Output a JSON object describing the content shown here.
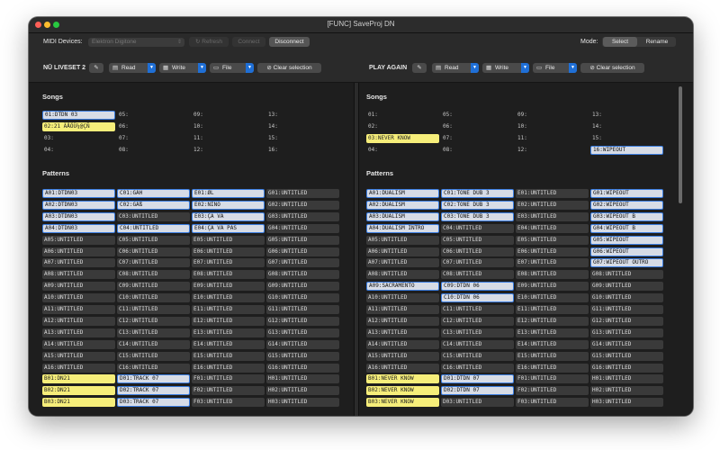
{
  "window": {
    "title": "[FUNC] SaveProj DN"
  },
  "toolbar": {
    "midi_label": "MIDI Devices:",
    "device_value": "Elektron Digitone",
    "refresh_label": "Refresh",
    "connect_label": "Connect",
    "disconnect_label": "Disconnect",
    "mode_label": "Mode:",
    "mode_select": "Select",
    "mode_rename": "Rename"
  },
  "left": {
    "name": "NŪ LIVESET 2",
    "read_label": "Read",
    "write_label": "Write",
    "file_label": "File",
    "clear_label": "Clear selection",
    "songs_title": "Songs",
    "patterns_title": "Patterns",
    "songs": [
      [
        "01:DTDN 03",
        "02:21 ÄÅÖÜ¼@ÇÑ",
        "03:",
        "04:"
      ],
      [
        "05:",
        "06:",
        "07:",
        "08:"
      ],
      [
        "09:",
        "10:",
        "11:",
        "12:"
      ],
      [
        "13:",
        "14:",
        "15:",
        "16:"
      ]
    ],
    "song_states": [
      [
        "sel",
        "yel",
        "plain",
        "plain"
      ],
      [
        "plain",
        "plain",
        "plain",
        "plain"
      ],
      [
        "plain",
        "plain",
        "plain",
        "plain"
      ],
      [
        "plain",
        "plain",
        "plain",
        "plain"
      ]
    ],
    "patterns": [
      [
        "A01:DTDN03",
        "A02:DTDN03",
        "A03:DTDN03",
        "A04:DTDN03",
        "A05:UNTITLED",
        "A06:UNTITLED",
        "A07:UNTITLED",
        "A08:UNTITLED",
        "A09:UNTITLED",
        "A10:UNTITLED",
        "A11:UNTITLED",
        "A12:UNTITLED",
        "A13:UNTITLED",
        "A14:UNTITLED",
        "A15:UNTITLED",
        "A16:UNTITLED",
        "B01:DN21",
        "B02:DN21",
        "B03:DN21"
      ],
      [
        "C01:GÄH",
        "C02:GÄß",
        "C03:UNTITLED",
        "C04:UNTITLED",
        "C05:UNTITLED",
        "C06:UNTITLED",
        "C07:UNTITLED",
        "C08:UNTITLED",
        "C09:UNTITLED",
        "C10:UNTITLED",
        "C11:UNTITLED",
        "C12:UNTITLED",
        "C13:UNTITLED",
        "C14:UNTITLED",
        "C15:UNTITLED",
        "C16:UNTITLED",
        "D01:TRACK 07",
        "D02:TRACK 07",
        "D03:TRACK 07"
      ],
      [
        "E01:ØL",
        "E02:NIÑO",
        "E03:ÇA VA",
        "E04:ÇA VA PAS",
        "E05:UNTITLED",
        "E06:UNTITLED",
        "E07:UNTITLED",
        "E08:UNTITLED",
        "E09:UNTITLED",
        "E10:UNTITLED",
        "E11:UNTITLED",
        "E12:UNTITLED",
        "E13:UNTITLED",
        "E14:UNTITLED",
        "E15:UNTITLED",
        "E16:UNTITLED",
        "F01:UNTITLED",
        "F02:UNTITLED",
        "F03:UNTITLED"
      ],
      [
        "G01:UNTITLED",
        "G02:UNTITLED",
        "G03:UNTITLED",
        "G04:UNTITLED",
        "G05:UNTITLED",
        "G06:UNTITLED",
        "G07:UNTITLED",
        "G08:UNTITLED",
        "G09:UNTITLED",
        "G10:UNTITLED",
        "G11:UNTITLED",
        "G12:UNTITLED",
        "G13:UNTITLED",
        "G14:UNTITLED",
        "G15:UNTITLED",
        "G16:UNTITLED",
        "H01:UNTITLED",
        "H02:UNTITLED",
        "H03:UNTITLED"
      ]
    ],
    "pattern_states": [
      [
        "sel",
        "sel",
        "sel",
        "sel",
        "",
        "",
        "",
        "",
        "",
        "",
        "",
        "",
        "",
        "",
        "",
        "",
        "yel",
        "yel",
        "yel"
      ],
      [
        "sel",
        "sel",
        "",
        "sel",
        "",
        "",
        "",
        "",
        "",
        "",
        "",
        "",
        "",
        "",
        "",
        "",
        "sel",
        "sel",
        "sel"
      ],
      [
        "sel",
        "sel",
        "sel",
        "sel",
        "",
        "",
        "",
        "",
        "",
        "",
        "",
        "",
        "",
        "",
        "",
        "",
        "",
        "",
        ""
      ],
      [
        "",
        "",
        "",
        "",
        "",
        "",
        "",
        "",
        "",
        "",
        "",
        "",
        "",
        "",
        "",
        "",
        "",
        "",
        ""
      ]
    ]
  },
  "right": {
    "name": "PLAY AGAIN",
    "read_label": "Read",
    "write_label": "Write",
    "file_label": "File",
    "clear_label": "Clear selection",
    "songs_title": "Songs",
    "patterns_title": "Patterns",
    "songs": [
      [
        "01:",
        "02:",
        "03:NEVER KNOW",
        "04:"
      ],
      [
        "05:",
        "06:",
        "07:",
        "08:"
      ],
      [
        "09:",
        "10:",
        "11:",
        "12:"
      ],
      [
        "13:",
        "14:",
        "15:",
        "16:WIPEOUT"
      ]
    ],
    "song_states": [
      [
        "plain",
        "plain",
        "yel",
        "plain"
      ],
      [
        "plain",
        "plain",
        "plain",
        "plain"
      ],
      [
        "plain",
        "plain",
        "plain",
        "plain"
      ],
      [
        "plain",
        "plain",
        "plain",
        "sel"
      ]
    ],
    "patterns": [
      [
        "A01:DUALISM",
        "A02:DUALISM",
        "A03:DUALISM",
        "A04:DUALISM INTRO",
        "A05:UNTITLED",
        "A06:UNTITLED",
        "A07:UNTITLED",
        "A08:UNTITLED",
        "A09:SACRAMENTO",
        "A10:UNTITLED",
        "A11:UNTITLED",
        "A12:UNTITLED",
        "A13:UNTITLED",
        "A14:UNTITLED",
        "A15:UNTITLED",
        "A16:UNTITLED",
        "B01:NEVER KNOW",
        "B02:NEVER KNOW",
        "B03:NEVER KNOW"
      ],
      [
        "C01:TONE DUB 3",
        "C02:TONE DUB 3",
        "C03:TONE DUB 3",
        "C04:UNTITLED",
        "C05:UNTITLED",
        "C06:UNTITLED",
        "C07:UNTITLED",
        "C08:UNTITLED",
        "C09:DTDN 06",
        "C10:DTDN 06",
        "C11:UNTITLED",
        "C12:UNTITLED",
        "C13:UNTITLED",
        "C14:UNTITLED",
        "C15:UNTITLED",
        "C16:UNTITLED",
        "D01:DTDN 07",
        "D02:DTDN 07",
        "D03:UNTITLED"
      ],
      [
        "E01:UNTITLED",
        "E02:UNTITLED",
        "E03:UNTITLED",
        "E04:UNTITLED",
        "E05:UNTITLED",
        "E06:UNTITLED",
        "E07:UNTITLED",
        "E08:UNTITLED",
        "E09:UNTITLED",
        "E10:UNTITLED",
        "E11:UNTITLED",
        "E12:UNTITLED",
        "E13:UNTITLED",
        "E14:UNTITLED",
        "E15:UNTITLED",
        "E16:UNTITLED",
        "F01:UNTITLED",
        "F02:UNTITLED",
        "F03:UNTITLED"
      ],
      [
        "G01:WIPEOUT",
        "G02:WIPEOUT",
        "G03:WIPEOUT B",
        "G04:WIPEOUT B",
        "G05:WIPEOUT",
        "G06:WIPEOUT",
        "G07:WIPEOUT OUTRO",
        "G08:UNTITLED",
        "G09:UNTITLED",
        "G10:UNTITLED",
        "G11:UNTITLED",
        "G12:UNTITLED",
        "G13:UNTITLED",
        "G14:UNTITLED",
        "G15:UNTITLED",
        "G16:UNTITLED",
        "H01:UNTITLED",
        "H02:UNTITLED",
        "H03:UNTITLED"
      ]
    ],
    "pattern_states": [
      [
        "sel",
        "sel",
        "sel",
        "sel",
        "",
        "",
        "",
        "",
        "sel",
        "",
        "",
        "",
        "",
        "",
        "",
        "",
        "yel",
        "yel",
        "yel"
      ],
      [
        "sel",
        "sel",
        "sel",
        "",
        "",
        "",
        "",
        "",
        "sel",
        "sel",
        "",
        "",
        "",
        "",
        "",
        "",
        "sel",
        "sel",
        ""
      ],
      [
        "",
        "",
        "",
        "",
        "",
        "",
        "",
        "",
        "",
        "",
        "",
        "",
        "",
        "",
        "",
        "",
        "",
        "",
        ""
      ],
      [
        "sel",
        "sel",
        "sel",
        "sel",
        "sel",
        "sel",
        "sel",
        "",
        "",
        "",
        "",
        "",
        "",
        "",
        "",
        "",
        "",
        "",
        ""
      ]
    ]
  },
  "colors": {
    "accent": "#1f6fd6",
    "selected_fill": "#d7dce6",
    "yellow_fill": "#f6ee7a",
    "close": "#ff5f57",
    "minimize": "#febc2e",
    "zoom": "#28c840"
  },
  "icons": [
    "refresh-icon",
    "edit-icon",
    "read-icon",
    "write-icon",
    "folder-icon",
    "clear-icon",
    "chevron-down-icon"
  ]
}
